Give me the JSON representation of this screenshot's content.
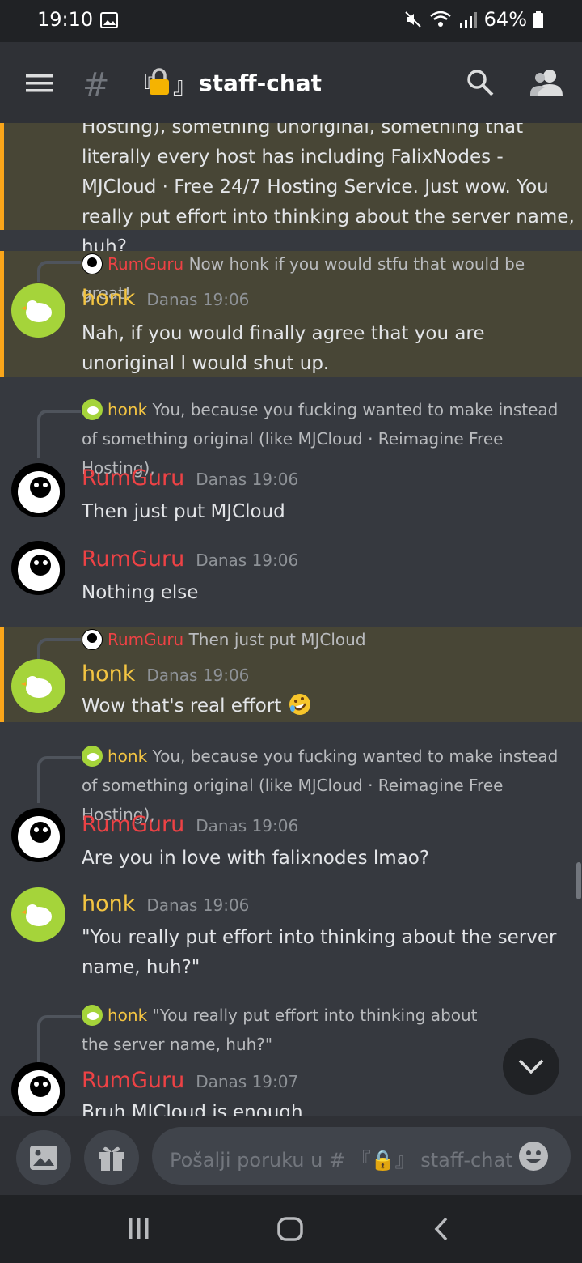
{
  "status": {
    "time": "19:10",
    "battery": "64%"
  },
  "header": {
    "hash": "#",
    "bracket_open": "『",
    "bracket_close": "』",
    "channel": "staff-chat"
  },
  "messages": {
    "m0": {
      "text": "Hosting), something unoriginal, something that literally every host has including FalixNodes - MJCloud · Free 24/7 Hosting Service. Just wow. You really put effort into thinking about the server name, huh?"
    },
    "m1": {
      "reply_author": "RumGuru",
      "reply_text": "Now honk if you would stfu that would be great!",
      "author": "honk",
      "time": "Danas 19:06",
      "text": "Nah, if you would finally agree that you are unoriginal I would shut up."
    },
    "m2": {
      "reply_author": "honk",
      "reply_text": "You, because you fucking wanted to make instead of something original (like MJCloud · Reimagine Free Hosting),",
      "author": "RumGuru",
      "time": "Danas 19:06",
      "text": "Then just put MJCloud"
    },
    "m3": {
      "author": "RumGuru",
      "time": "Danas 19:06",
      "text": "Nothing else"
    },
    "m4": {
      "reply_author": "RumGuru",
      "reply_text": "Then just put MJCloud",
      "author": "honk",
      "time": "Danas 19:06",
      "text": "Wow that's real effort"
    },
    "m5": {
      "reply_author": "honk",
      "reply_text": "You, because you fucking wanted to make instead of something original (like MJCloud · Reimagine Free Hosting),",
      "author": "RumGuru",
      "time": "Danas 19:06",
      "text": "Are you in love with falixnodes lmao?"
    },
    "m6": {
      "author": "honk",
      "time": "Danas 19:06",
      "text": "\"You really put effort into thinking about the server name, huh?\""
    },
    "m7": {
      "reply_author": "honk",
      "reply_text": "\"You really put effort into thinking about the server name, huh?\"",
      "author": "RumGuru",
      "time": "Danas 19:07",
      "text": "Bruh MJCloud is enough"
    }
  },
  "composer": {
    "placeholder": "Pošalji poruku u # 『🔒』 staff-chat"
  },
  "colors": {
    "accent_honk": "#f4c542",
    "accent_rumguru": "#ed4245",
    "highlight": "#faa61a",
    "background": "#36393f"
  }
}
